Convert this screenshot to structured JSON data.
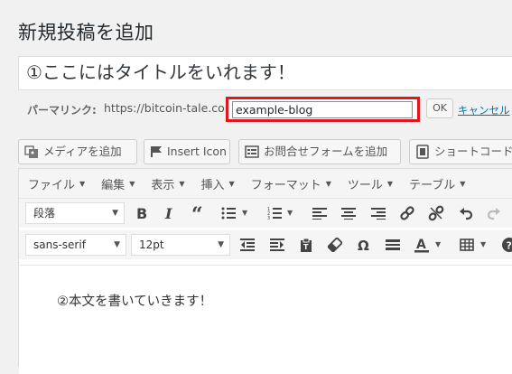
{
  "page": {
    "title": "新規投稿を追加"
  },
  "post": {
    "title_value": "①ここにはタイトルをいれます！",
    "permalink_label": "パーマリンク:",
    "permalink_base": "https://bitcoin-tale.com",
    "slug_value": "example-blog",
    "ok_label": "OK",
    "cancel_label": "キャンセル"
  },
  "media_buttons": [
    {
      "label": "メディアを追加",
      "icon": "media-icon"
    },
    {
      "label": "Insert Icon",
      "icon": "flag-icon"
    },
    {
      "label": "お問合せフォームを追加",
      "icon": "form-icon"
    },
    {
      "label": "ショートコード",
      "icon": "shortcode-icon"
    }
  ],
  "editor": {
    "menus": [
      "ファイル",
      "編集",
      "表示",
      "挿入",
      "フォーマット",
      "ツール",
      "テーブル"
    ],
    "format_select": "段落",
    "font_family_select": "sans-serif",
    "font_size_select": "12pt",
    "content_text": "②本文を書いていきます！"
  },
  "colors": {
    "highlight": "#e2161e",
    "link": "#0073aa",
    "background": "#f1f1f1"
  }
}
